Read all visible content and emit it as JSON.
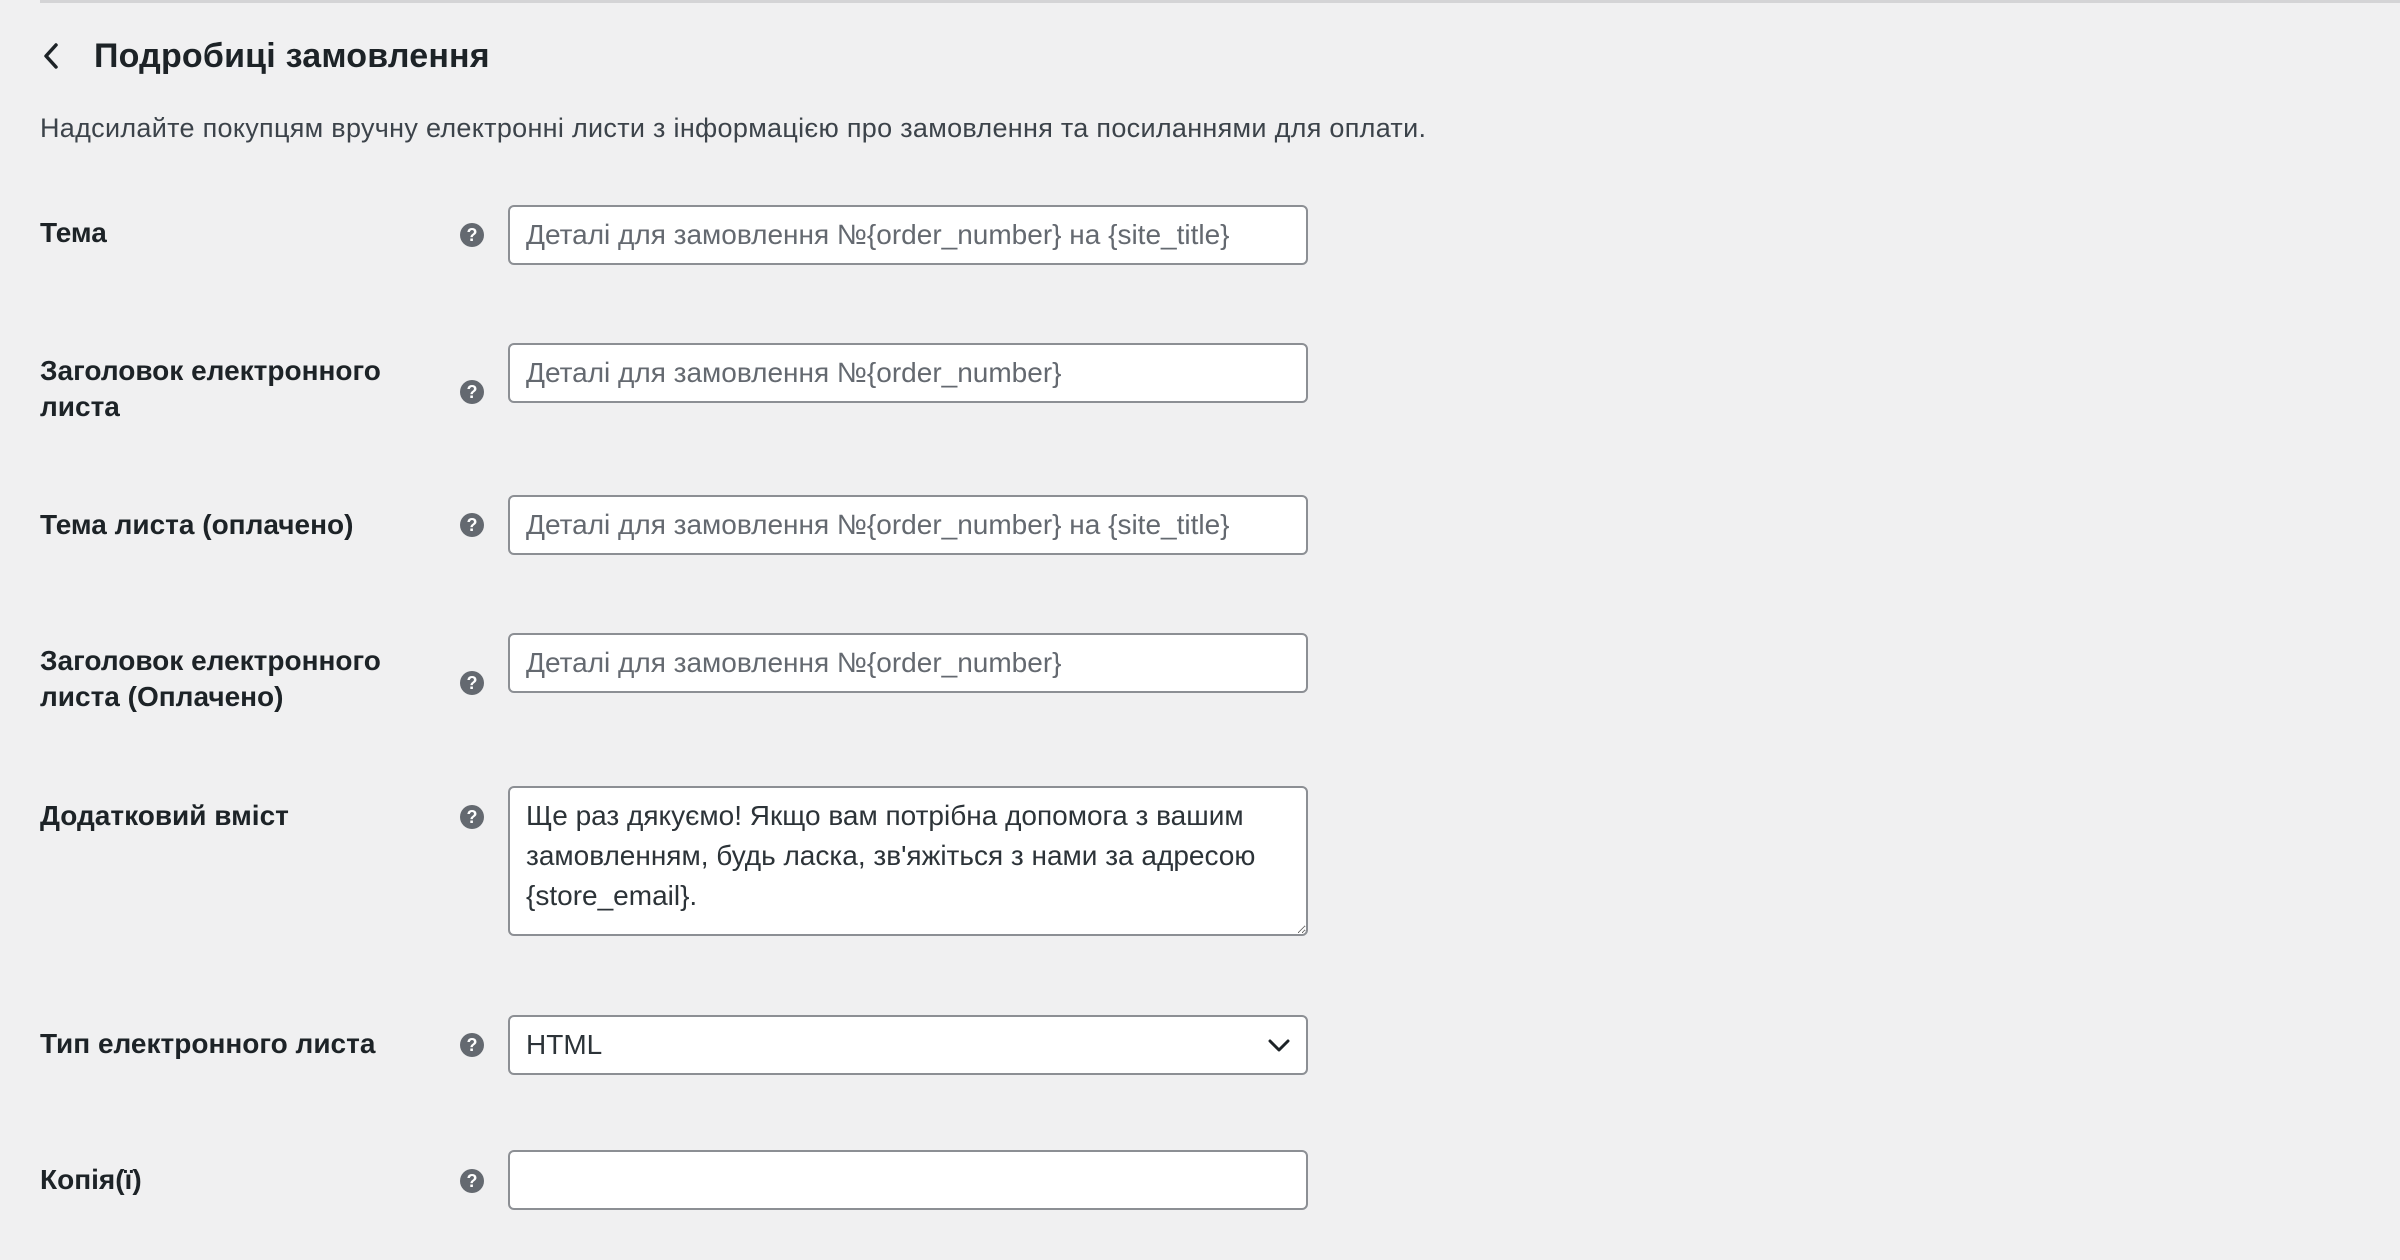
{
  "header": {
    "title": "Подробиці замовлення",
    "back_icon": "chevron-left-icon"
  },
  "description": "Надсилайте покупцям вручну електронні листи з інформацією про замовлення та посиланнями для оплати.",
  "fields": {
    "subject": {
      "label": "Тема",
      "placeholder": "Деталі для замовлення №{order_number} на {site_title}"
    },
    "heading": {
      "label_line1": "Заголовок електронного",
      "label_line2": "листа",
      "placeholder": "Деталі для замовлення №{order_number}"
    },
    "subject_paid": {
      "label": "Тема листа (оплачено)",
      "placeholder": "Деталі для замовлення №{order_number} на {site_title}"
    },
    "heading_paid": {
      "label_line1": "Заголовок електронного",
      "label_line2": "листа (Оплачено)",
      "placeholder": "Деталі для замовлення №{order_number}"
    },
    "additional_content": {
      "label": "Додатковий вміст",
      "value": "Ще раз дякуємо! Якщо вам потрібна допомога з вашим замовленням, будь ласка, зв'яжіться з нами за адресою {store_email}."
    },
    "email_type": {
      "label": "Тип електронного листа",
      "selected": "HTML"
    },
    "cc": {
      "label": "Копія(ї)",
      "value": ""
    }
  },
  "help_icon": "help-icon",
  "help_glyph": "?"
}
